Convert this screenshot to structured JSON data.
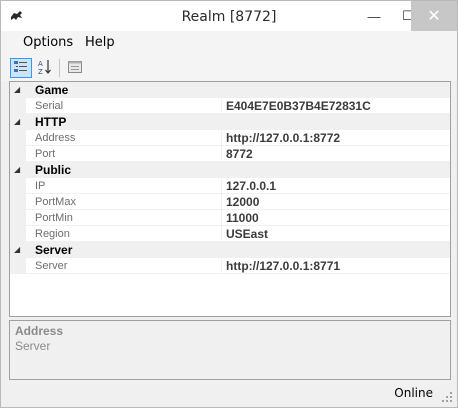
{
  "window": {
    "title": "Realm [8772]"
  },
  "titlebar_buttons": {
    "minimize": "—",
    "maximize": "☐",
    "close": "✕"
  },
  "menu": {
    "options": "Options",
    "help": "Help"
  },
  "toolbar": {
    "categorized_icon": "categorized-icon",
    "alphabetical_icon": "alphabetical-icon",
    "property_pages_icon": "property-pages-icon"
  },
  "property_grid": {
    "categories": [
      {
        "name": "Game",
        "properties": [
          {
            "name": "Serial",
            "value": "E404E7E0B37B4E72831C"
          }
        ]
      },
      {
        "name": "HTTP",
        "properties": [
          {
            "name": "Address",
            "value": "http://127.0.0.1:8772"
          },
          {
            "name": "Port",
            "value": "8772"
          }
        ]
      },
      {
        "name": "Public",
        "properties": [
          {
            "name": "IP",
            "value": "127.0.0.1"
          },
          {
            "name": "PortMax",
            "value": "12000"
          },
          {
            "name": "PortMin",
            "value": "11000"
          },
          {
            "name": "Region",
            "value": "USEast"
          }
        ]
      },
      {
        "name": "Server",
        "properties": [
          {
            "name": "Server",
            "value": "http://127.0.0.1:8771"
          }
        ]
      }
    ]
  },
  "description": {
    "title": "Address",
    "text": "Server"
  },
  "status": {
    "text": "Online"
  },
  "colors": {
    "selection_bg": "#cce4f7",
    "selection_border": "#3399ff",
    "grid_line": "#f0f0f0",
    "label_gray": "#6d6d6d"
  }
}
